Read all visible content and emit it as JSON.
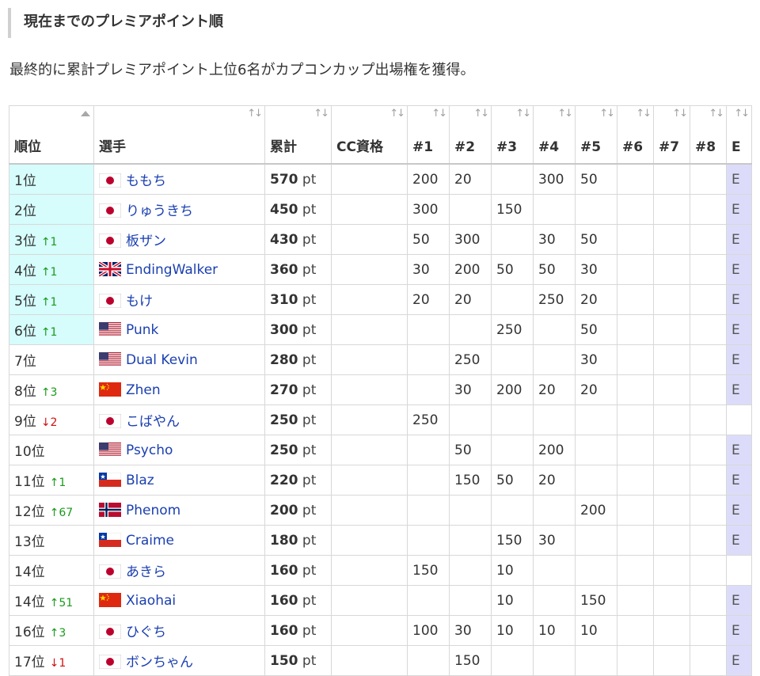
{
  "section_heading": "現在までのプレミアポイント順",
  "intro_text": "最終的に累計プレミアポイント上位6名がカプコンカップ出場権を獲得。",
  "table": {
    "headers": {
      "rank": "順位",
      "player": "選手",
      "total": "累計",
      "cc": "CC資格",
      "e1": "#1",
      "e2": "#2",
      "e3": "#3",
      "e4": "#4",
      "e5": "#5",
      "e6": "#6",
      "e7": "#7",
      "e8": "#8",
      "evo": "E"
    },
    "sort_icon": "↑↓",
    "unit": "pt",
    "rows": [
      {
        "rank": "1位",
        "move": "",
        "dir": "",
        "flag": "jp",
        "name": "ももち",
        "total": "570",
        "cc": "",
        "e": [
          "200",
          "20",
          "",
          "300",
          "50",
          "",
          "",
          ""
        ],
        "evo": "E",
        "qualified": true
      },
      {
        "rank": "2位",
        "move": "",
        "dir": "",
        "flag": "jp",
        "name": "りゅうきち",
        "total": "450",
        "cc": "",
        "e": [
          "300",
          "",
          "150",
          "",
          "",
          "",
          "",
          ""
        ],
        "evo": "E",
        "qualified": true
      },
      {
        "rank": "3位",
        "move": "↑1",
        "dir": "up",
        "flag": "jp",
        "name": "板ザン",
        "total": "430",
        "cc": "",
        "e": [
          "50",
          "300",
          "",
          "30",
          "50",
          "",
          "",
          ""
        ],
        "evo": "E",
        "qualified": true
      },
      {
        "rank": "4位",
        "move": "↑1",
        "dir": "up",
        "flag": "uk",
        "name": "EndingWalker",
        "total": "360",
        "cc": "",
        "e": [
          "30",
          "200",
          "50",
          "50",
          "30",
          "",
          "",
          ""
        ],
        "evo": "E",
        "qualified": true
      },
      {
        "rank": "5位",
        "move": "↑1",
        "dir": "up",
        "flag": "jp",
        "name": "もけ",
        "total": "310",
        "cc": "",
        "e": [
          "20",
          "20",
          "",
          "250",
          "20",
          "",
          "",
          ""
        ],
        "evo": "E",
        "qualified": true
      },
      {
        "rank": "6位",
        "move": "↑1",
        "dir": "up",
        "flag": "us",
        "name": "Punk",
        "total": "300",
        "cc": "",
        "e": [
          "",
          "",
          "250",
          "",
          "50",
          "",
          "",
          ""
        ],
        "evo": "E",
        "qualified": true
      },
      {
        "rank": "7位",
        "move": "",
        "dir": "",
        "flag": "us",
        "name": "Dual Kevin",
        "total": "280",
        "cc": "",
        "e": [
          "",
          "250",
          "",
          "",
          "30",
          "",
          "",
          ""
        ],
        "evo": "E",
        "qualified": false
      },
      {
        "rank": "8位",
        "move": "↑3",
        "dir": "up",
        "flag": "cn",
        "name": "Zhen",
        "total": "270",
        "cc": "",
        "e": [
          "",
          "30",
          "200",
          "20",
          "20",
          "",
          "",
          ""
        ],
        "evo": "E",
        "qualified": false
      },
      {
        "rank": "9位",
        "move": "↓2",
        "dir": "down",
        "flag": "jp",
        "name": "こばやん",
        "total": "250",
        "cc": "",
        "e": [
          "250",
          "",
          "",
          "",
          "",
          "",
          "",
          ""
        ],
        "evo": "",
        "qualified": false
      },
      {
        "rank": "10位",
        "move": "",
        "dir": "",
        "flag": "us",
        "name": "Psycho",
        "total": "250",
        "cc": "",
        "e": [
          "",
          "50",
          "",
          "200",
          "",
          "",
          "",
          ""
        ],
        "evo": "E",
        "qualified": false
      },
      {
        "rank": "11位",
        "move": "↑1",
        "dir": "up",
        "flag": "cl",
        "name": "Blaz",
        "total": "220",
        "cc": "",
        "e": [
          "",
          "150",
          "50",
          "20",
          "",
          "",
          "",
          ""
        ],
        "evo": "E",
        "qualified": false
      },
      {
        "rank": "12位",
        "move": "↑67",
        "dir": "up",
        "flag": "no",
        "name": "Phenom",
        "total": "200",
        "cc": "",
        "e": [
          "",
          "",
          "",
          "",
          "200",
          "",
          "",
          ""
        ],
        "evo": "E",
        "qualified": false
      },
      {
        "rank": "13位",
        "move": "",
        "dir": "",
        "flag": "cl",
        "name": "Craime",
        "total": "180",
        "cc": "",
        "e": [
          "",
          "",
          "150",
          "30",
          "",
          "",
          "",
          ""
        ],
        "evo": "E",
        "qualified": false
      },
      {
        "rank": "14位",
        "move": "",
        "dir": "",
        "flag": "jp",
        "name": "あきら",
        "total": "160",
        "cc": "",
        "e": [
          "150",
          "",
          "10",
          "",
          "",
          "",
          "",
          ""
        ],
        "evo": "",
        "qualified": false
      },
      {
        "rank": "14位",
        "move": "↑51",
        "dir": "up",
        "flag": "cn",
        "name": "Xiaohai",
        "total": "160",
        "cc": "",
        "e": [
          "",
          "",
          "10",
          "",
          "150",
          "",
          "",
          ""
        ],
        "evo": "E",
        "qualified": false
      },
      {
        "rank": "16位",
        "move": "↑3",
        "dir": "up",
        "flag": "jp",
        "name": "ひぐち",
        "total": "160",
        "cc": "",
        "e": [
          "100",
          "30",
          "10",
          "10",
          "10",
          "",
          "",
          ""
        ],
        "evo": "E",
        "qualified": false
      },
      {
        "rank": "17位",
        "move": "↓1",
        "dir": "down",
        "flag": "jp",
        "name": "ボンちゃん",
        "total": "150",
        "cc": "",
        "e": [
          "",
          "150",
          "",
          "",
          "",
          "",
          "",
          ""
        ],
        "evo": "E",
        "qualified": false
      }
    ]
  }
}
